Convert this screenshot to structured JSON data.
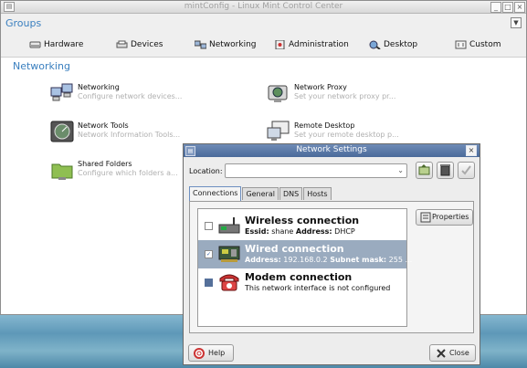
{
  "window": {
    "title": "mintConfig - Linux Mint Control Center",
    "icon": "window-menu-icon",
    "buttons": [
      "minimize",
      "maximize",
      "close"
    ]
  },
  "groups": {
    "title": "Groups",
    "items": [
      {
        "label": "Hardware",
        "icon": "hardware-icon"
      },
      {
        "label": "Devices",
        "icon": "devices-icon"
      },
      {
        "label": "Networking",
        "icon": "networking-icon"
      },
      {
        "label": "Administration",
        "icon": "administration-icon"
      },
      {
        "label": "Desktop",
        "icon": "desktop-icon"
      },
      {
        "label": "Custom",
        "icon": "custom-icon"
      }
    ]
  },
  "section": {
    "title": "Networking",
    "items": [
      {
        "name": "Networking",
        "desc": "Configure network devices..."
      },
      {
        "name": "Network Proxy",
        "desc": "Set your network proxy pr..."
      },
      {
        "name": "Network Tools",
        "desc": "Network Information Tools..."
      },
      {
        "name": "Remote Desktop",
        "desc": "Set your remote desktop p..."
      },
      {
        "name": "Shared Folders",
        "desc": "Configure which folders a..."
      }
    ]
  },
  "dialog": {
    "title": "Network Settings",
    "location_label": "Location:",
    "location_value": "",
    "tabs": [
      "Connections",
      "General",
      "DNS",
      "Hosts"
    ],
    "active_tab": "Connections",
    "connections": [
      {
        "name": "Wireless connection",
        "detail_parts": [
          {
            "b": "Essid:"
          },
          {
            "t": " shane "
          },
          {
            "b": "Address:"
          },
          {
            "t": " DHCP"
          }
        ],
        "checked": false,
        "selected": false
      },
      {
        "name": "Wired connection",
        "detail_parts": [
          {
            "b": "Address:"
          },
          {
            "t": " 192.168.0.2 "
          },
          {
            "b": "Subnet mask:"
          },
          {
            "t": " 255 ..."
          }
        ],
        "checked": true,
        "selected": true
      },
      {
        "name": "Modem connection",
        "detail_parts": [
          {
            "t": "This network interface is not configured"
          }
        ],
        "checked": false,
        "selected": false
      }
    ],
    "properties_label": "Properties",
    "help_label": "Help",
    "close_label": "Close"
  },
  "colors": {
    "accent": "#3a7fbf",
    "selection": "#9aabbf",
    "dialog_title": "#4a6a9a"
  }
}
